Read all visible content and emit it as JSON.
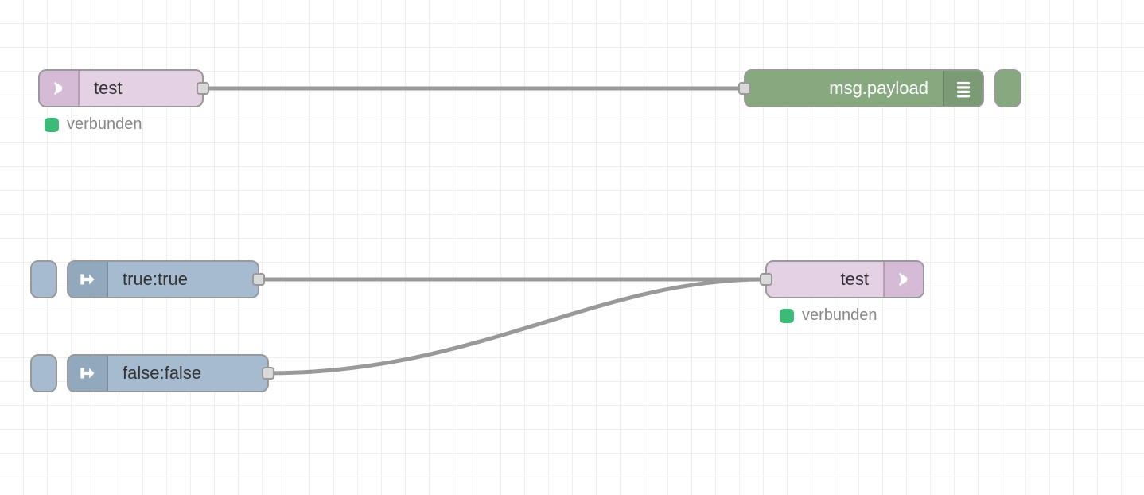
{
  "nodes": {
    "mqtt_in": {
      "label": "test",
      "status": "verbunden",
      "type": "mqtt-in"
    },
    "debug": {
      "label": "msg.payload",
      "type": "debug"
    },
    "inject_true": {
      "label": "true:true",
      "type": "inject"
    },
    "inject_false": {
      "label": "false:false",
      "type": "inject"
    },
    "mqtt_out": {
      "label": "test",
      "status": "verbunden",
      "type": "mqtt-out"
    }
  },
  "colors": {
    "status_connected": "#3eba78",
    "wire": "#999999"
  },
  "wires": [
    {
      "from": "mqtt_in",
      "to": "debug"
    },
    {
      "from": "inject_true",
      "to": "mqtt_out"
    },
    {
      "from": "inject_false",
      "to": "mqtt_out"
    }
  ]
}
